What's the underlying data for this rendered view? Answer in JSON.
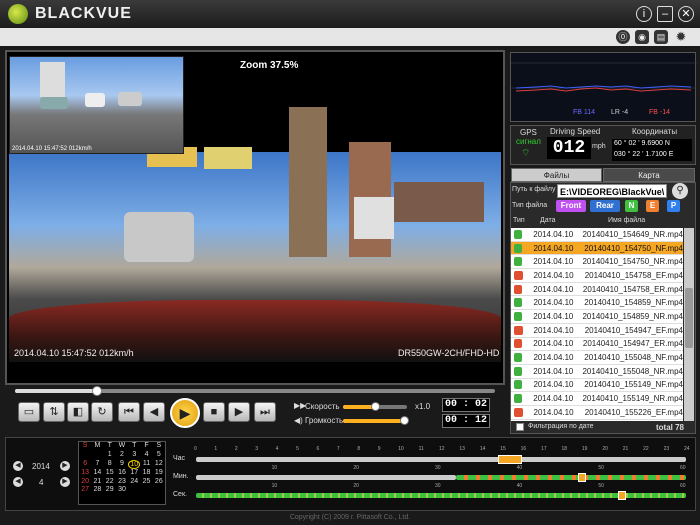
{
  "app": {
    "title": "BLACKVUE"
  },
  "window_controls": [
    "i",
    "–",
    "✕"
  ],
  "toolbar_icons": [
    "settings-icon",
    "printer-icon",
    "camera-icon",
    "info-icon"
  ],
  "video": {
    "zoom_label": "Zoom 37.5%",
    "timestamp_overlay": "2014.04.10 15:47:52  012km/h",
    "model_overlay": "DR550GW-2CH/FHD-HD",
    "pip_timestamp": "2014.04.10 15:47:52  012km/h"
  },
  "playback": {
    "progress": 0.17,
    "speed_label": "Скорость",
    "speed_value": "x1.0",
    "speed_level": 0.5,
    "volume_label": "Громкость",
    "volume_level": 0.95,
    "time_elapsed": "00 : 02",
    "time_total": "00 : 12"
  },
  "graph": {
    "labels": [
      "FB 114",
      "LR -4",
      "FB -14"
    ]
  },
  "gps": {
    "gps_label": "GPS",
    "signal_label": "сигнал",
    "speed_label": "Driving Speed",
    "speed_value": "012",
    "speed_unit": "mph",
    "coords_label": "Координаты",
    "lat": "60 ° 02 ' 9.6900 N",
    "lon": "030 ° 22 ' 1.7100 E"
  },
  "tabs": [
    "Файлы",
    "Карта"
  ],
  "files": {
    "path_label": "Путь к файлу",
    "path_value": "E:\\VIDEOREG\\BlackVue\\",
    "type_label": "Тип файла",
    "filters": [
      "Front",
      "Rear",
      "N",
      "E",
      "P"
    ],
    "col_type": "Тип",
    "col_date": "Дата",
    "col_name": "Имя файла",
    "rows": [
      {
        "date": "2014.04.10",
        "name": "20140410_154649_NR.mp4",
        "kind": "N",
        "selected": false
      },
      {
        "date": "2014.04.10",
        "name": "20140410_154750_NF.mp4",
        "kind": "N",
        "selected": true
      },
      {
        "date": "2014.04.10",
        "name": "20140410_154750_NR.mp4",
        "kind": "N",
        "selected": false
      },
      {
        "date": "2014.04.10",
        "name": "20140410_154758_EF.mp4",
        "kind": "E",
        "selected": false
      },
      {
        "date": "2014.04.10",
        "name": "20140410_154758_ER.mp4",
        "kind": "E",
        "selected": false
      },
      {
        "date": "2014.04.10",
        "name": "20140410_154859_NF.mp4",
        "kind": "N",
        "selected": false
      },
      {
        "date": "2014.04.10",
        "name": "20140410_154859_NR.mp4",
        "kind": "N",
        "selected": false
      },
      {
        "date": "2014.04.10",
        "name": "20140410_154947_EF.mp4",
        "kind": "E",
        "selected": false
      },
      {
        "date": "2014.04.10",
        "name": "20140410_154947_ER.mp4",
        "kind": "E",
        "selected": false
      },
      {
        "date": "2014.04.10",
        "name": "20140410_155048_NF.mp4",
        "kind": "N",
        "selected": false
      },
      {
        "date": "2014.04.10",
        "name": "20140410_155048_NR.mp4",
        "kind": "N",
        "selected": false
      },
      {
        "date": "2014.04.10",
        "name": "20140410_155149_NF.mp4",
        "kind": "N",
        "selected": false
      },
      {
        "date": "2014.04.10",
        "name": "20140410_155149_NR.mp4",
        "kind": "N",
        "selected": false
      },
      {
        "date": "2014.04.10",
        "name": "20140410_155226_EF.mp4",
        "kind": "E",
        "selected": false
      }
    ],
    "date_filter_label": "Фильтрация по дате",
    "total_label": "total 78"
  },
  "calendar": {
    "year": "2014",
    "month": "4",
    "weekdays": [
      "S",
      "M",
      "T",
      "W",
      "T",
      "F",
      "S"
    ],
    "weeks": [
      [
        "",
        "",
        "1",
        "2",
        "3",
        "4",
        "5"
      ],
      [
        "6",
        "7",
        "8",
        "9",
        "10",
        "11",
        "12"
      ],
      [
        "13",
        "14",
        "15",
        "16",
        "17",
        "18",
        "19"
      ],
      [
        "20",
        "21",
        "22",
        "23",
        "24",
        "25",
        "26"
      ],
      [
        "27",
        "28",
        "29",
        "30",
        "",
        "",
        ""
      ]
    ],
    "highlight_day": "10"
  },
  "timeline": {
    "hour_label": "Час",
    "min_label": "Мин.",
    "sec_label": "Сек.",
    "hours": [
      "0",
      "1",
      "2",
      "3",
      "4",
      "5",
      "6",
      "7",
      "8",
      "9",
      "10",
      "11",
      "12",
      "13",
      "14",
      "15",
      "16",
      "17",
      "18",
      "19",
      "20",
      "21",
      "22",
      "23",
      "24"
    ],
    "mins": [
      "10",
      "20",
      "30",
      "40",
      "50",
      "60"
    ]
  },
  "copyright": "Copyright (C) 2009 г. Pittasoft Co., Ltd.",
  "colors": {
    "accent": "#f5a623",
    "bg": "#1a1a1a"
  }
}
